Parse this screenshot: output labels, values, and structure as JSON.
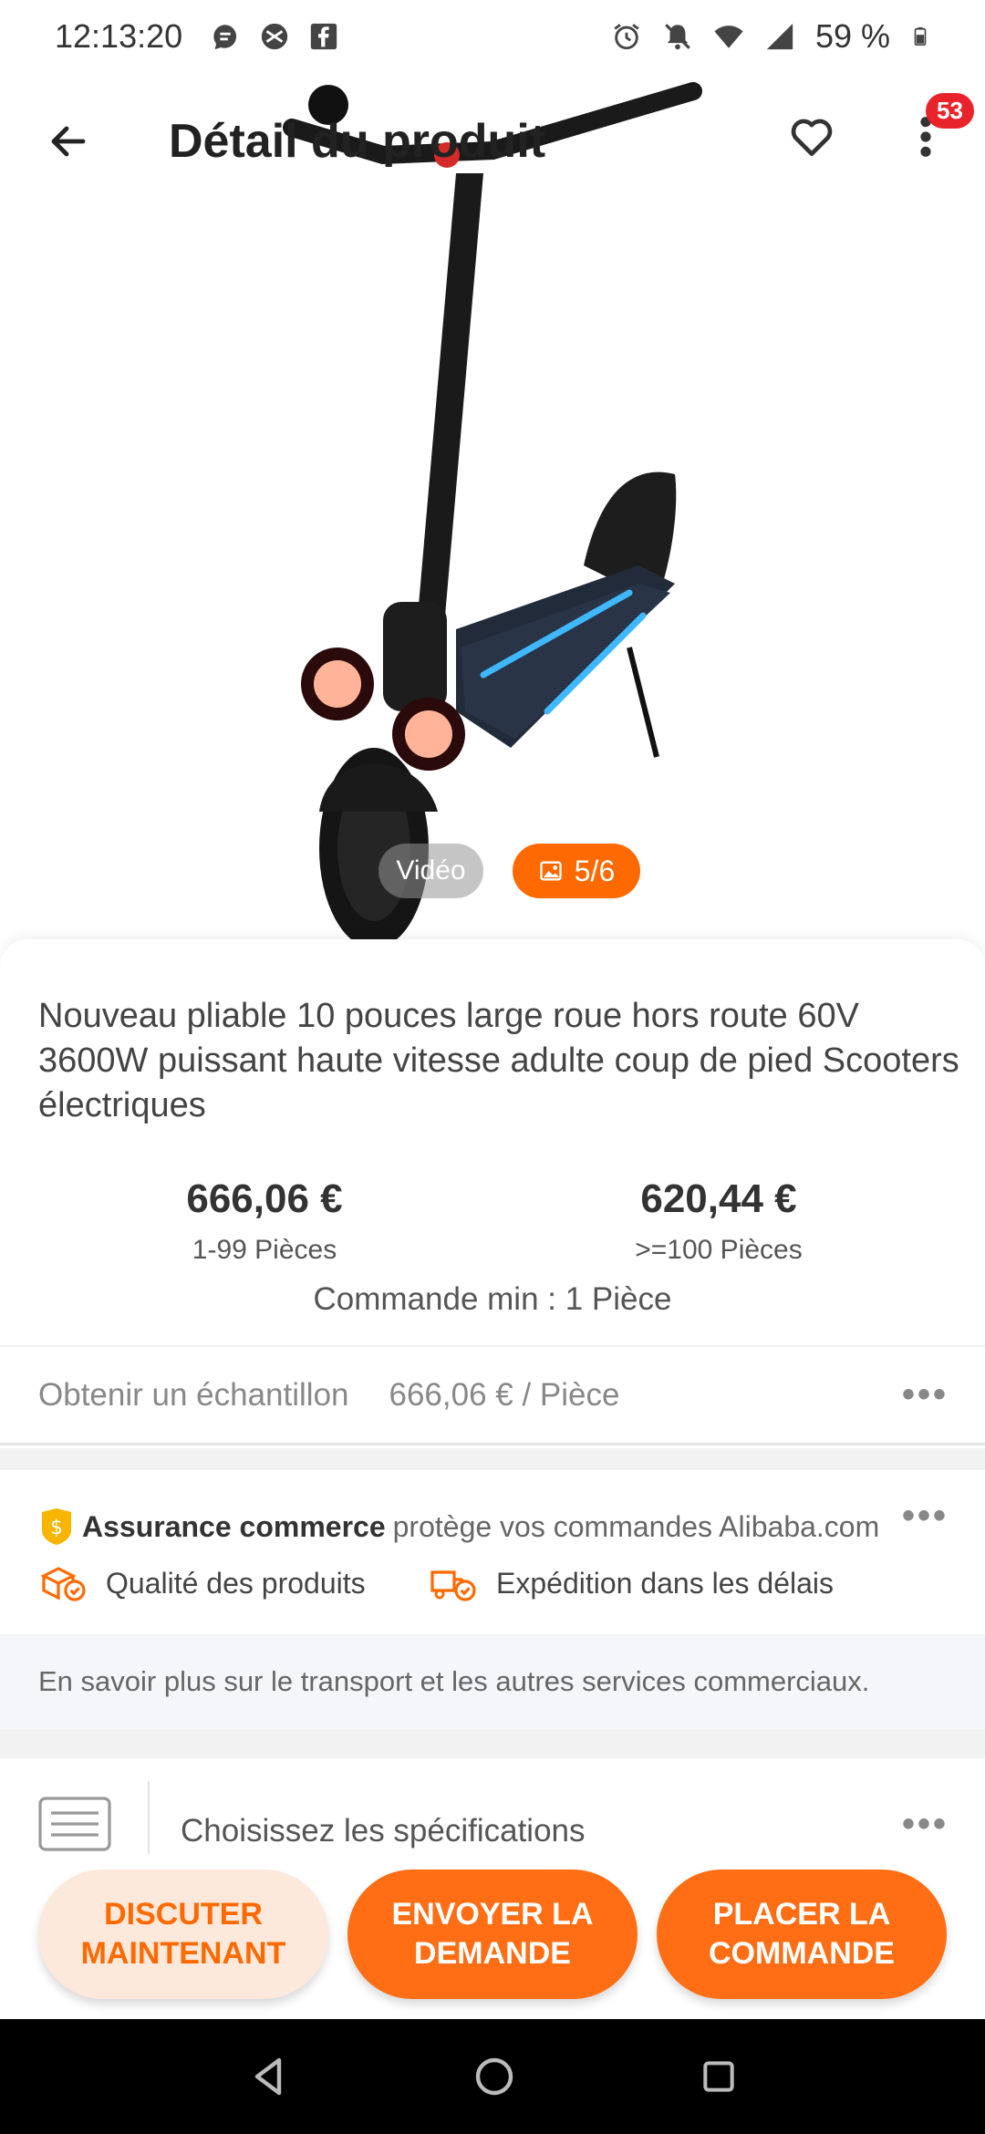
{
  "status_bar": {
    "time": "12:13:20",
    "battery": "59 %",
    "icons_left": [
      "chat-bubble-icon",
      "vpn-icon",
      "facebook-icon"
    ],
    "icons_right": [
      "alarm-icon",
      "muted-bell-icon",
      "wifi-icon",
      "cellular-icon",
      "battery-icon"
    ]
  },
  "topbar": {
    "title": "Détail du produit",
    "notification_count": "53"
  },
  "media": {
    "video_label": "Vidéo",
    "image_counter": "5/6"
  },
  "product": {
    "title": "Nouveau pliable 10 pouces large roue hors route 60V 3600W puissant haute vitesse adulte coup de pied Scooters électriques",
    "prices": [
      {
        "price": "666,06 €",
        "quantity": "1-99 Pièces"
      },
      {
        "price": "620,44 €",
        "quantity": ">=100 Pièces"
      }
    ],
    "min_order": "Commande min : 1 Pièce"
  },
  "sample": {
    "label": "Obtenir un échantillon",
    "price": "666,06 € / Pièce"
  },
  "assurance": {
    "bold": "Assurance commerce",
    "rest": "protège vos commandes Alibaba.com",
    "features": [
      "Qualité des produits",
      "Expédition dans les délais"
    ]
  },
  "info_strip": "En savoir plus sur le transport et les autres services commerciaux.",
  "specs": {
    "label": "Choisissez les spécifications"
  },
  "actions": {
    "chat": "DISCUTER MAINTENANT",
    "send": "ENVOYER LA DEMANDE",
    "order": "PLACER LA COMMANDE"
  },
  "colors": {
    "accent": "#ff6a00",
    "badge": "#e8232b",
    "chat_bg": "#fde8dc"
  }
}
